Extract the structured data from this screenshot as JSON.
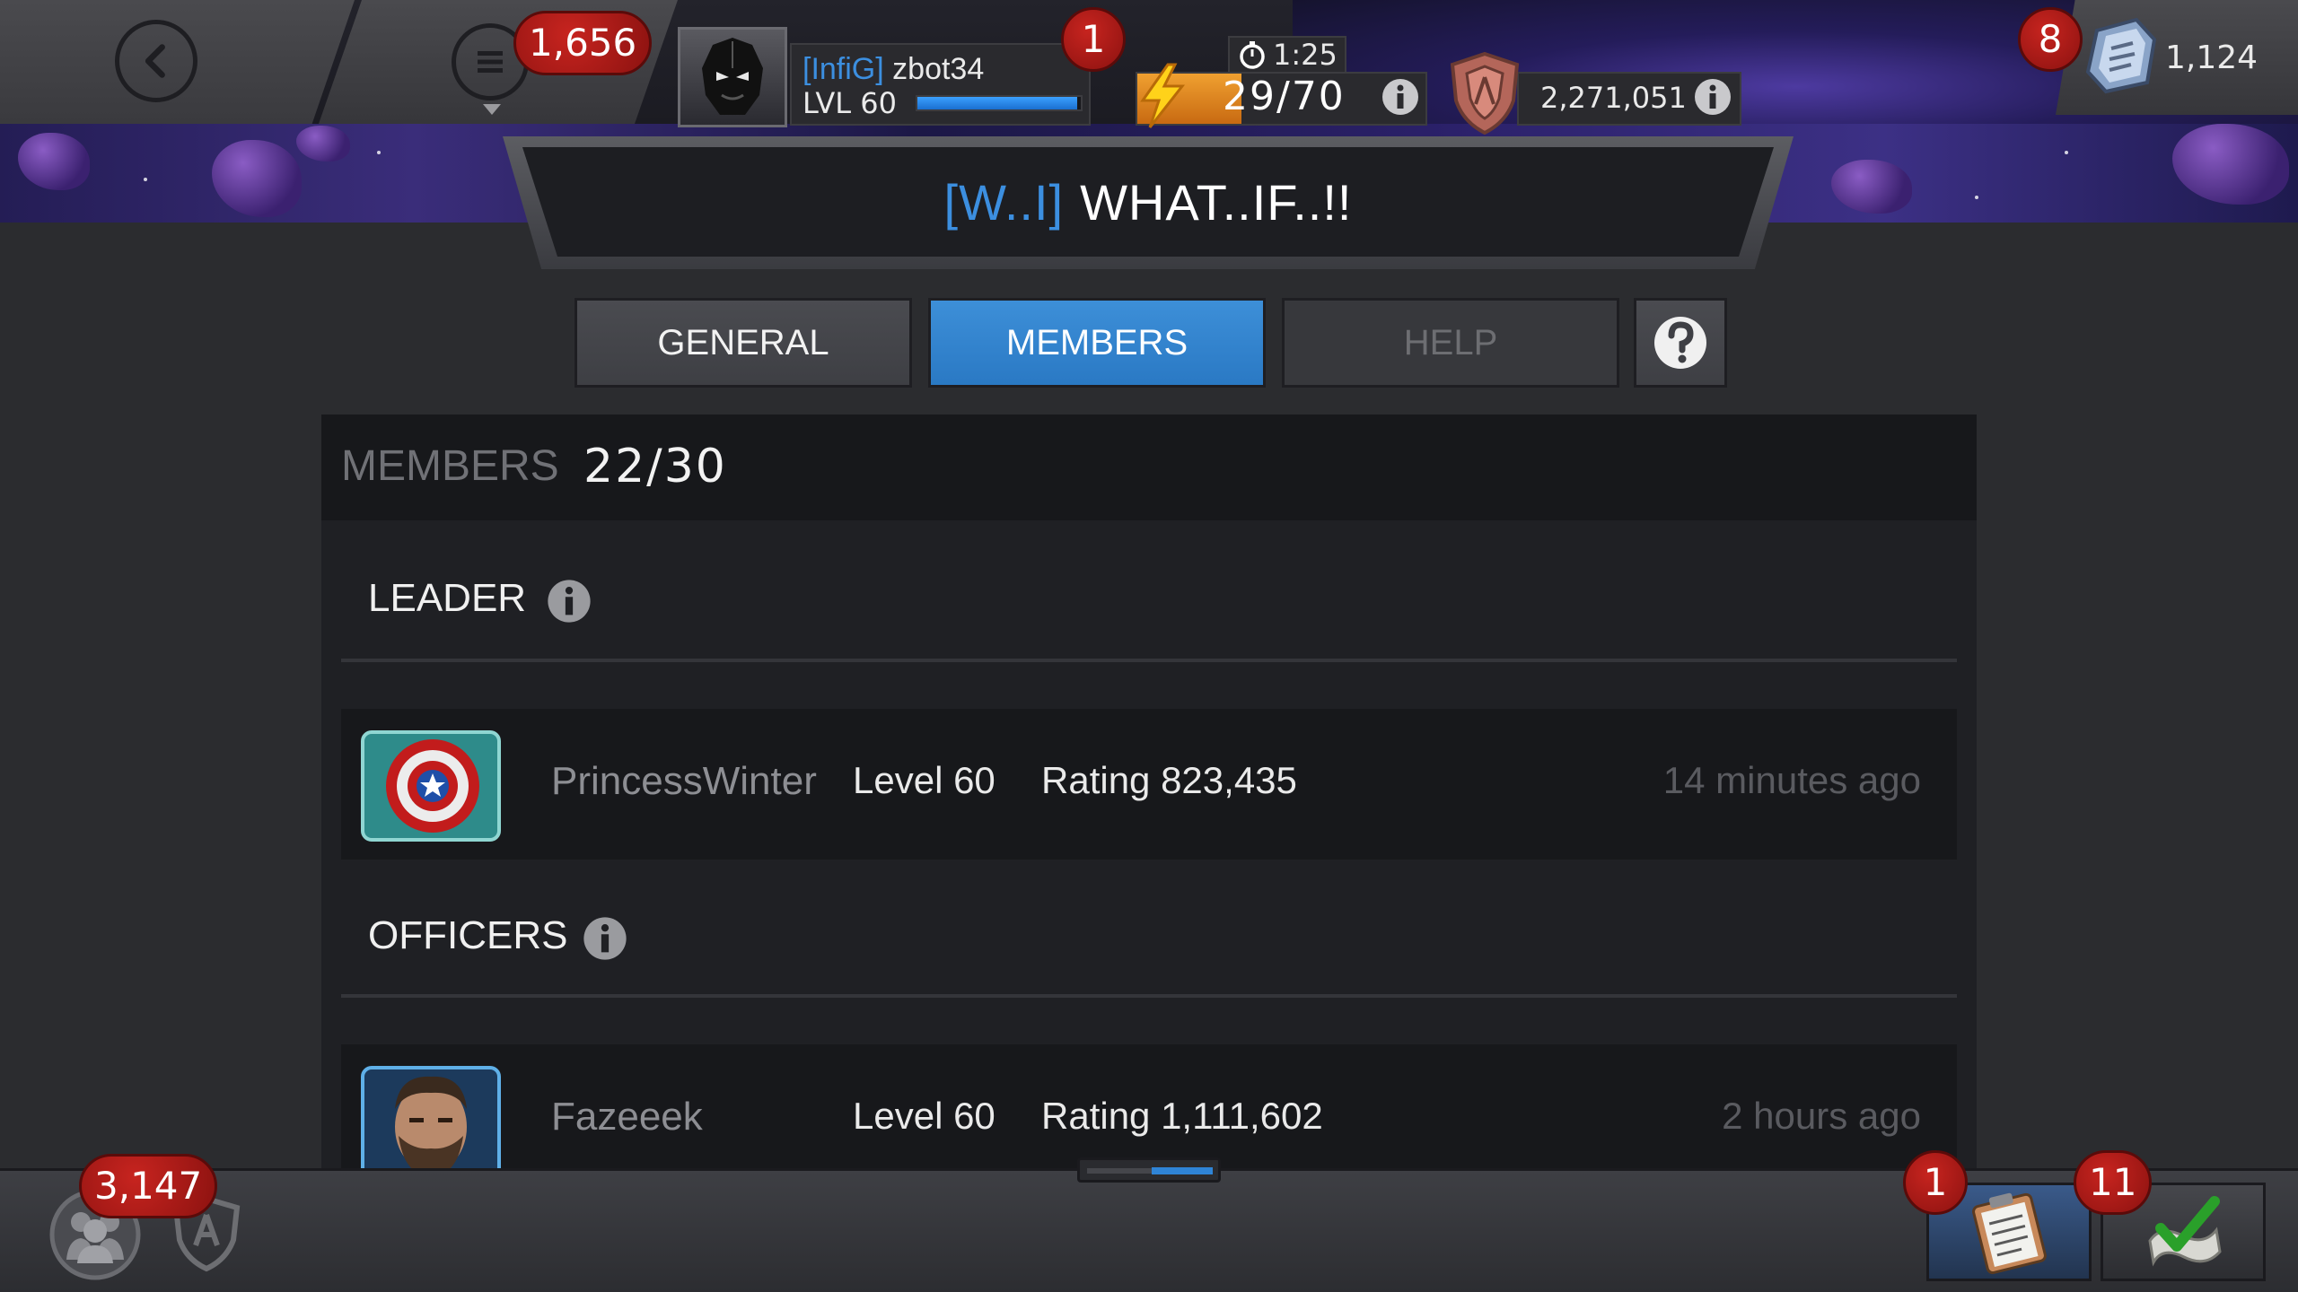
{
  "header": {
    "back_label": "back",
    "menu_badge": "1,656",
    "player": {
      "alliance_tag": "[InfiG]",
      "name": "zbot34",
      "level": "LVL 60",
      "xp_fraction": 0.98
    },
    "notifications_badge": "1",
    "energy": {
      "timer": "1:25",
      "value": "29/70",
      "fraction": 0.36
    },
    "rating": "2,271,051",
    "units": {
      "badge": "8",
      "value": "1,124"
    }
  },
  "alliance": {
    "tag": "[W..I]",
    "name": "WHAT..IF..!!"
  },
  "tabs": [
    {
      "label": "GENERAL",
      "state": "inactive"
    },
    {
      "label": "MEMBERS",
      "state": "active"
    },
    {
      "label": "HELP",
      "state": "disabled"
    }
  ],
  "members_panel": {
    "label": "MEMBERS",
    "count": "22/30",
    "sections": [
      {
        "title": "LEADER",
        "members": [
          {
            "name": "PrincessWinter",
            "level": "Level 60",
            "rating": "Rating 823,435",
            "last_seen": "14 minutes ago",
            "avatar": "captain-america-shield"
          }
        ]
      },
      {
        "title": "OFFICERS",
        "members": [
          {
            "name": "Fazeeek",
            "level": "Level 60",
            "rating": "Rating 1,111,602",
            "last_seen": "2 hours ago",
            "avatar": "bearded-hero"
          }
        ]
      }
    ]
  },
  "footer": {
    "social_badge": "3,147",
    "quests_badge": "1",
    "objectives_badge": "11"
  },
  "colors": {
    "accent_blue": "#2a79c4",
    "alliance_tag_blue": "#3c8fe0",
    "badge_red": "#b51d1a",
    "energy_orange": "#e08a24"
  }
}
